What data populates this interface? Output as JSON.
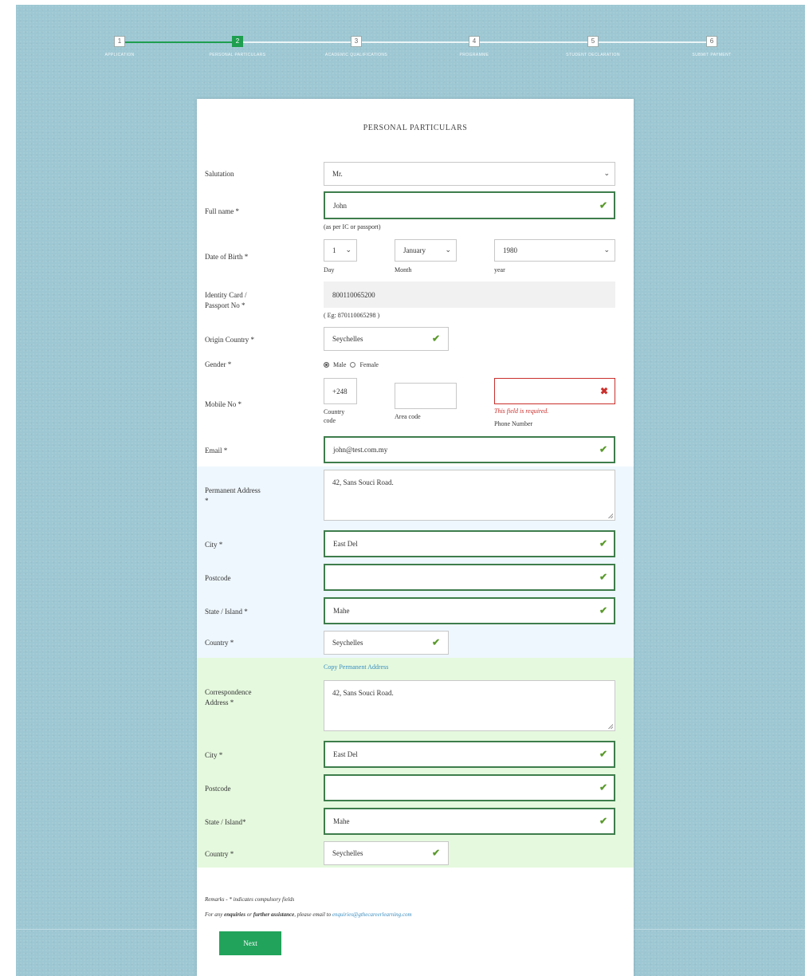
{
  "stepper": {
    "steps": [
      {
        "num": "1",
        "label": "APPLICATION"
      },
      {
        "num": "2",
        "label": "PERSONAL PARTICULARS"
      },
      {
        "num": "3",
        "label": "ACADEMIC QUALIFICATIONS"
      },
      {
        "num": "4",
        "label": "PROGRAMME"
      },
      {
        "num": "5",
        "label": "STUDENT DECLARATION"
      },
      {
        "num": "6",
        "label": "SUBMIT PAYMENT"
      }
    ],
    "active_index": 1
  },
  "form": {
    "title": "PERSONAL PARTICULARS",
    "salutation": {
      "label": "Salutation",
      "value": "Mr."
    },
    "full_name": {
      "label": "Full name *",
      "value": "John",
      "hint": "(as per IC or passport)"
    },
    "dob": {
      "label": "Date of Birth *",
      "day": "1",
      "month": "January",
      "year": "1980",
      "day_hint": "Day",
      "month_hint": "Month",
      "year_hint": "year"
    },
    "id_card": {
      "label_1": "Identity Card /",
      "label_2": "Passport No *",
      "value": "800110065200",
      "hint": "( Eg: 870110065298 )"
    },
    "origin_country": {
      "label": "Origin Country *",
      "value": "Seychelles"
    },
    "gender": {
      "label": "Gender *",
      "option_male": "Male",
      "option_female": "Female",
      "selected": "Male"
    },
    "mobile": {
      "label": "Mobile No *",
      "country_code": "+248",
      "area_code": "",
      "phone": "",
      "country_hint_1": "Country",
      "country_hint_2": "code",
      "area_hint": "Area code",
      "phone_hint": "Phone Number",
      "error": "This field is required."
    },
    "email": {
      "label": "Email *",
      "value": "john@test.com.my"
    },
    "permanent": {
      "address_label_1": "Permanent Address",
      "address_label_2": "*",
      "address": "42, Sans Souci Road.",
      "city_label": "City *",
      "city": "East Del",
      "postcode_label": "Postcode",
      "postcode": "",
      "state_label": "State / Island *",
      "state": "Mahe",
      "country_label": "Country *",
      "country": "Seychelles"
    },
    "copy_link": "Copy Permanent Address",
    "correspondence": {
      "address_label_1": "Correspondence",
      "address_label_2": "Address *",
      "address": "42, Sans Souci Road.",
      "city_label": "City *",
      "city": "East Del",
      "postcode_label": "Postcode",
      "postcode": "",
      "state_label": "State / Island*",
      "state": "Mahe",
      "country_label": "Country *",
      "country": "Seychelles"
    },
    "remarks_1": "Remarks - * indicates compulsory fields",
    "remarks_2_a": "For any",
    "remarks_2_b": "enquiries",
    "remarks_2_c": "or",
    "remarks_2_d": "further assistance",
    "remarks_2_e": ", please email to",
    "remarks_email": "enquiries@gthecareerlearning.com",
    "next_label": "Next"
  },
  "icons": {
    "valid": "checkmark-icon",
    "invalid": "cross-icon",
    "dropdown": "chevron-down-icon"
  },
  "colors": {
    "background": "#9dc7d3",
    "accent_green": "#21a35b",
    "valid_border": "#3e7d4c",
    "error": "#c9302c",
    "permanent_band": "#eef7fd",
    "correspondence_band": "#e5f9de"
  }
}
